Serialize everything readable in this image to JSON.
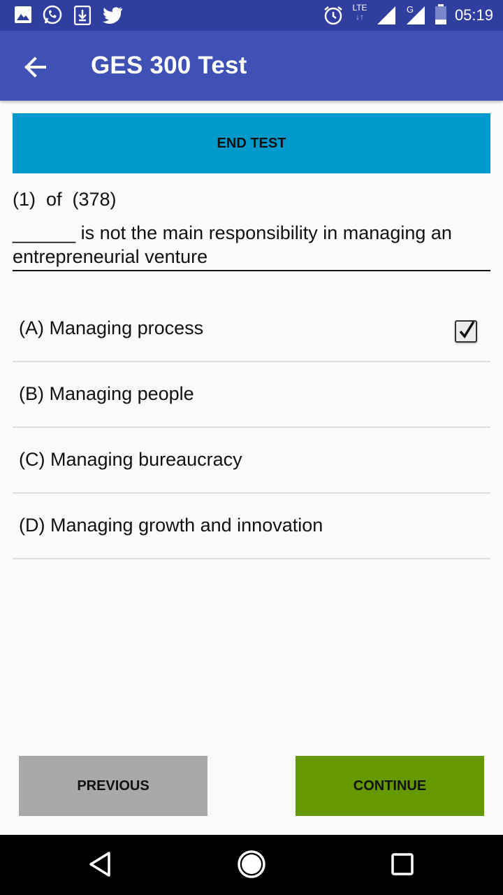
{
  "status_bar": {
    "time": "05:19",
    "network_label": "LTE",
    "signal2_label": "G",
    "left_icons": [
      "gallery-icon",
      "whatsapp-icon",
      "download-icon",
      "twitter-icon"
    ],
    "right_icons": [
      "alarm-icon",
      "lte-icon",
      "signal-icon",
      "signal-g-icon",
      "battery-icon"
    ]
  },
  "app_bar": {
    "title": "GES 300 Test",
    "back_icon": "arrow-back-icon"
  },
  "end_test_label": "END TEST",
  "counter": "(1)  of  (378)",
  "question": "______ is not the main responsibility in managing an entrepreneurial venture",
  "options": [
    {
      "label": "(A) Managing process",
      "checked": true
    },
    {
      "label": "(B) Managing people",
      "checked": false
    },
    {
      "label": "(C) Managing bureaucracy",
      "checked": false
    },
    {
      "label": "(D) Managing growth and innovation",
      "checked": false
    }
  ],
  "buttons": {
    "previous": "PREVIOUS",
    "continue": "CONTINUE"
  },
  "colors": {
    "status_bar": "#303f9f",
    "app_bar": "#3f51b5",
    "end_test": "#0099cc",
    "previous": "#a9a9a9",
    "continue": "#669900"
  }
}
